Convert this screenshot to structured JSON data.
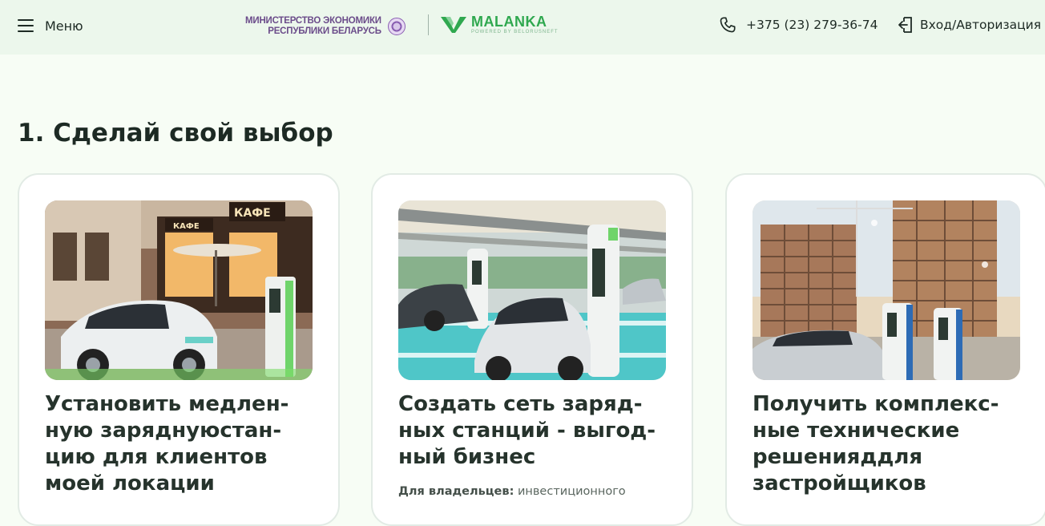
{
  "header": {
    "menu_label": "Меню",
    "ministry_line1": "МИНИСТЕРСТВО ЭКОНОМИКИ",
    "ministry_line2": "РЕСПУБЛИКИ БЕЛАРУСЬ",
    "brand_name": "MALANKA",
    "brand_tagline": "POWERED BY BELORUSNEFT",
    "phone": "+375 (23) 279-36-74",
    "login_label": "Вход/Авторизация"
  },
  "main": {
    "section_title": "1. Сделай свой выбор",
    "cards": [
      {
        "title": "Установить медлен-\nную заряднуюстан-\nцию для клиентов\nмоей локации",
        "image_signs": [
          "КАФЕ",
          "КАФЕ"
        ]
      },
      {
        "title": "Создать сеть заряд-\nных станций - выгод-\nный бизнес",
        "desc_bold": "Для владельцев:",
        "desc_text": " инвестиционного"
      },
      {
        "title": "Получить комплекс-\nные технические\nрешенияддля\nзастройщиков"
      }
    ]
  },
  "colors": {
    "page_bg": "#f7fdf5",
    "header_bg": "#ecf7ec",
    "brand_green": "#2fa84f",
    "ministry_purple": "#6b4c8a",
    "text_dark": "#1d2a24"
  },
  "icons": {
    "menu": "hamburger-icon",
    "phone": "phone-icon",
    "login": "login-icon"
  }
}
